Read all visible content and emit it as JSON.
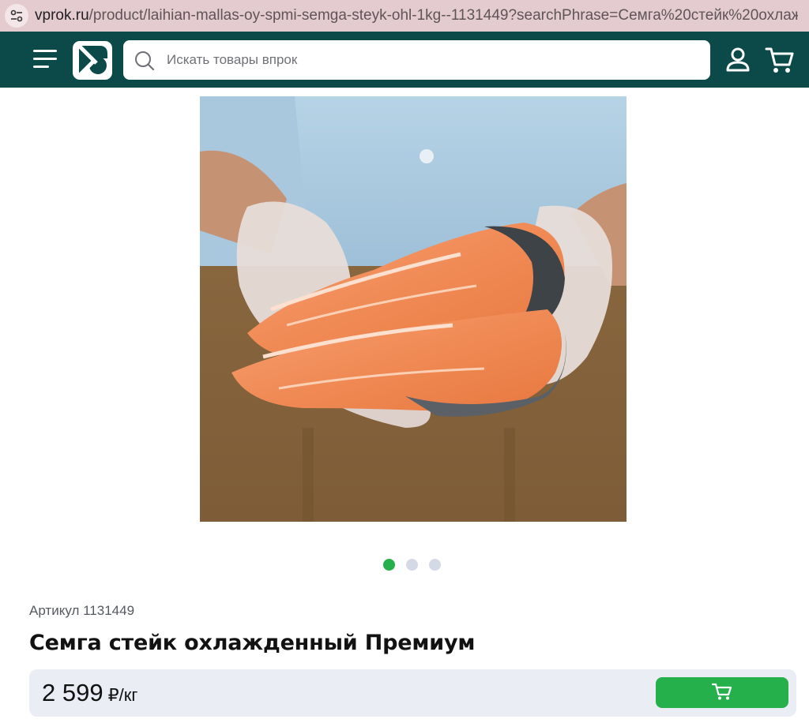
{
  "browser": {
    "url_host": "vprok.ru",
    "url_path": "/product/laihian-mallas-oy-spmi-semga-steyk-ohl-1kg--1131449?searchPhrase=Семга%20стейк%20охлажденный..."
  },
  "header": {
    "search_placeholder": "Искать товары впрок",
    "menu_icon": "hamburger-menu-icon",
    "logo_icon": "vprok-logo",
    "user_icon": "user-icon",
    "cart_icon": "cart-icon"
  },
  "gallery": {
    "image_alt": "salmon steaks held in gloved hands",
    "active_slide": 1,
    "slides_total": 3
  },
  "product": {
    "article": "Артикул 1131449",
    "title": "Семга стейк охлажденный Премиум",
    "price": "2 599",
    "unit": "₽/кг"
  },
  "colors": {
    "header_bg": "#0b4a49",
    "accent_green": "#25b04b",
    "price_panel_bg": "#eaedf4"
  }
}
